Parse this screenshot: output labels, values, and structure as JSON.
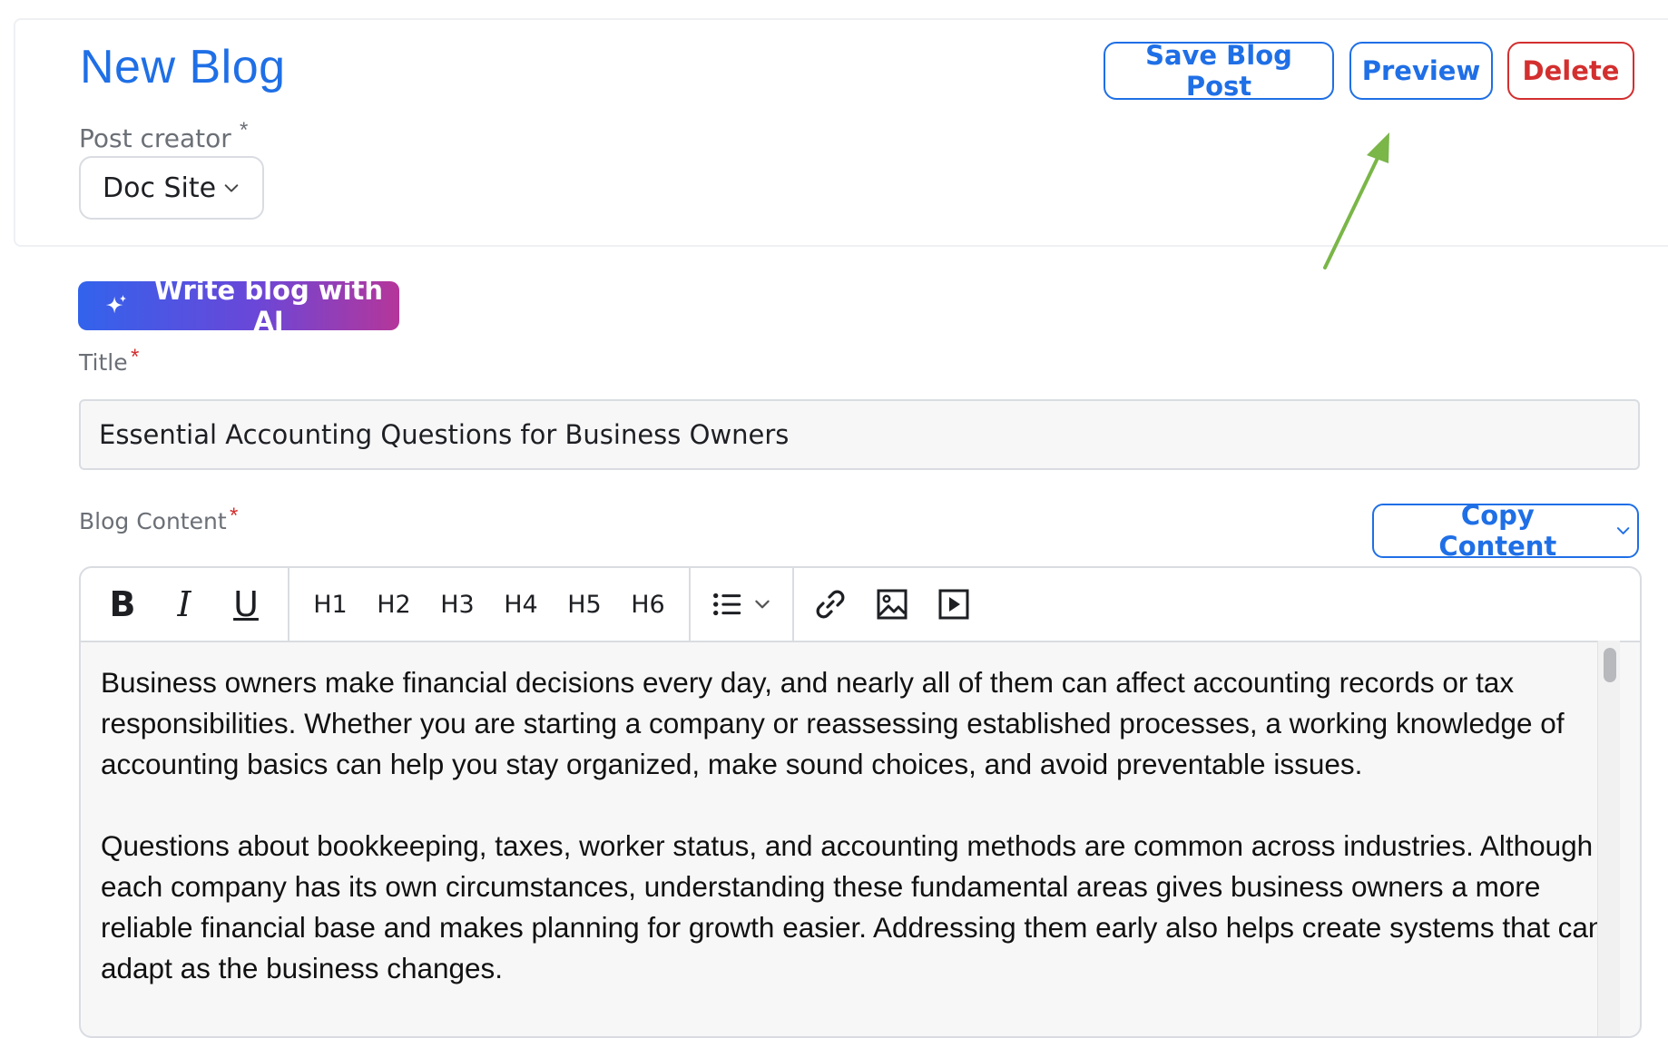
{
  "header": {
    "title": "New Blog",
    "save_label": "Save Blog Post",
    "preview_label": "Preview",
    "delete_label": "Delete"
  },
  "post_creator": {
    "label": "Post creator",
    "required_mark": "*",
    "value": "Doc Site"
  },
  "ai_button": {
    "label": "Write blog with AI",
    "icon": "sparkle-icon"
  },
  "title_field": {
    "label": "Title",
    "required_mark": "*",
    "value": "Essential Accounting Questions for Business Owners"
  },
  "content_field": {
    "label": "Blog Content",
    "required_mark": "*",
    "copy_label": "Copy Content"
  },
  "toolbar": {
    "bold": "B",
    "italic": "I",
    "underline": "U",
    "headings": [
      "H1",
      "H2",
      "H3",
      "H4",
      "H5",
      "H6"
    ],
    "icons": [
      "bold-icon",
      "italic-icon",
      "underline-icon",
      "list-icon",
      "link-icon",
      "image-icon",
      "video-icon"
    ]
  },
  "editor": {
    "paragraphs": [
      "Business owners make financial decisions every day, and nearly all of them can affect accounting records or tax responsibilities. Whether you are starting a company or reassessing established processes, a working knowledge of accounting basics can help you stay organized, make sound choices, and avoid preventable issues.",
      "Questions about bookkeeping, taxes, worker status, and accounting methods are common across industries. Although each company has its own circumstances, understanding these fundamental areas gives business owners a more reliable financial base and makes planning for growth easier. Addressing them early also helps create systems that can adapt as the business changes."
    ]
  },
  "colors": {
    "accent": "#1f6fe6",
    "danger": "#d32f2f",
    "annotation_arrow": "#7ab648"
  }
}
